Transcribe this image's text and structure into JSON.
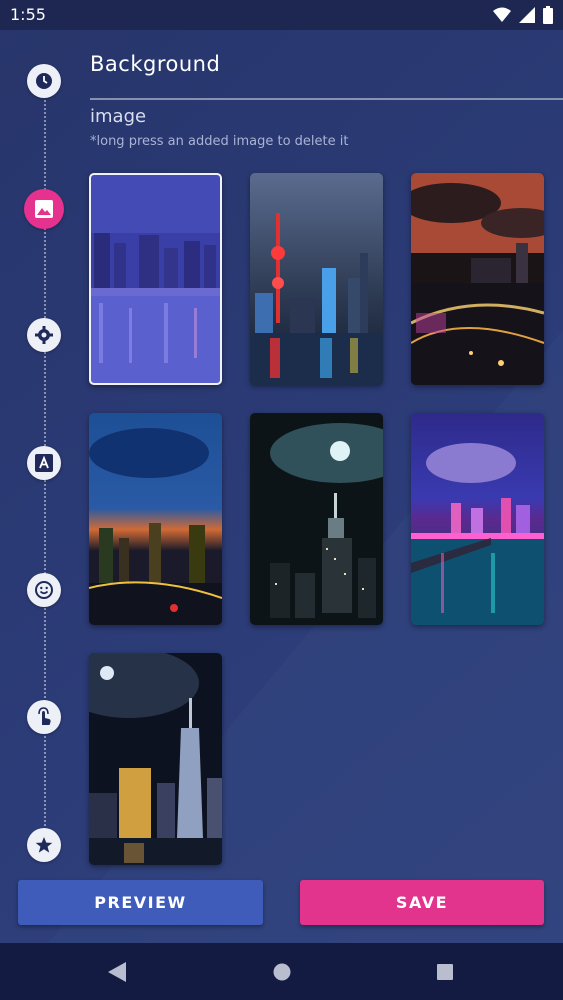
{
  "status_bar": {
    "time": "1:55"
  },
  "header": {
    "title": "Background",
    "subtitle": "image",
    "hint": "*long press an added image to delete it"
  },
  "timeline": {
    "items": [
      {
        "icon": "clock-icon"
      },
      {
        "icon": "image-icon",
        "active": true
      },
      {
        "icon": "gear-icon"
      },
      {
        "icon": "font-icon"
      },
      {
        "icon": "smiley-icon"
      },
      {
        "icon": "touch-icon"
      },
      {
        "icon": "star-icon"
      }
    ]
  },
  "images": [
    {
      "name": "city-night-skyline-purple",
      "selected": true
    },
    {
      "name": "shanghai-pearl-tower"
    },
    {
      "name": "city-red-sky"
    },
    {
      "name": "city-sunset-blue-clouds"
    },
    {
      "name": "empire-state-moon"
    },
    {
      "name": "harbor-neon-pink"
    },
    {
      "name": "one-world-trade-moon"
    }
  ],
  "buttons": {
    "preview": "PREVIEW",
    "save": "SAVE"
  },
  "colors": {
    "accent_pink": "#e2338d",
    "accent_blue": "#3f5cbb",
    "background": "#2a3a74"
  }
}
